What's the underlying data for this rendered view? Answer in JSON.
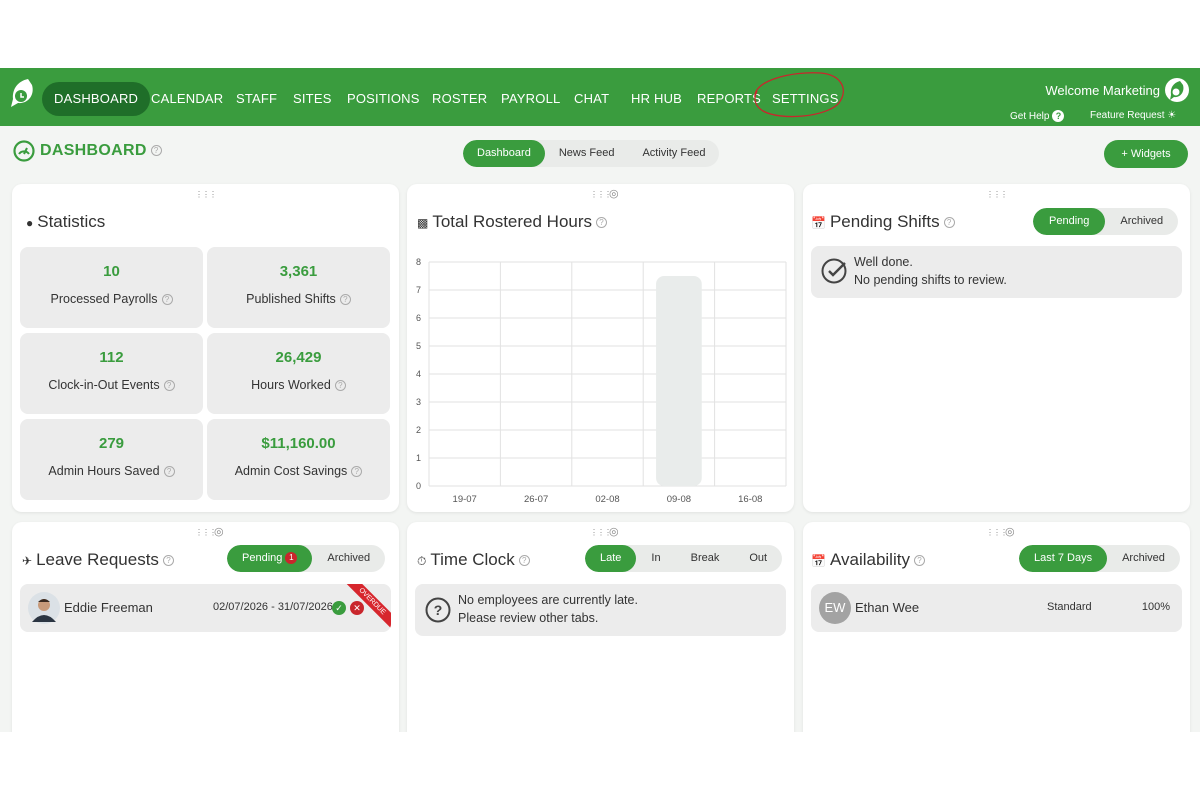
{
  "brand_color": "#3a9c3e",
  "nav": {
    "items": [
      {
        "label": "DASHBOARD",
        "active": true
      },
      {
        "label": "CALENDAR"
      },
      {
        "label": "STAFF"
      },
      {
        "label": "SITES"
      },
      {
        "label": "POSITIONS"
      },
      {
        "label": "ROSTER"
      },
      {
        "label": "PAYROLL"
      },
      {
        "label": "CHAT"
      },
      {
        "label": "HR HUB"
      },
      {
        "label": "REPORTS"
      },
      {
        "label": "SETTINGS"
      }
    ],
    "welcome": "Welcome Marketing",
    "get_help": "Get Help",
    "feature_request": "Feature Request"
  },
  "page": {
    "title": "DASHBOARD",
    "tabs": [
      "Dashboard",
      "News Feed",
      "Activity Feed"
    ],
    "active_tab": "Dashboard",
    "widgets_button": "+ Widgets"
  },
  "statistics": {
    "title": "Statistics",
    "items": [
      {
        "value": "10",
        "label": "Processed Payrolls"
      },
      {
        "value": "3,361",
        "label": "Published Shifts"
      },
      {
        "value": "112",
        "label": "Clock-in-Out Events"
      },
      {
        "value": "26,429",
        "label": "Hours Worked"
      },
      {
        "value": "279",
        "label": "Admin Hours Saved"
      },
      {
        "value": "$11,160.00",
        "label": "Admin Cost Savings"
      }
    ]
  },
  "rostered": {
    "title": "Total Rostered Hours"
  },
  "chart_data": {
    "type": "bar",
    "categories": [
      "19-07",
      "26-07",
      "02-08",
      "09-08",
      "16-08"
    ],
    "values": [
      0,
      0,
      0,
      7.5,
      0
    ],
    "title": "Total Rostered Hours",
    "ylim": [
      0,
      8
    ],
    "yticks": [
      "0",
      "1",
      "2",
      "3",
      "4",
      "5",
      "6",
      "7",
      "8"
    ],
    "grid": true,
    "bar_color": "#e9eceb"
  },
  "pending_shifts": {
    "title": "Pending Shifts",
    "tabs": [
      "Pending",
      "Archived"
    ],
    "line1": "Well done.",
    "line2": "No pending shifts to review."
  },
  "leave": {
    "title": "Leave Requests",
    "tabs": [
      "Pending",
      "Archived"
    ],
    "pending_count": "1",
    "request": {
      "name": "Eddie Freeman",
      "dates": "02/07/2026 - 31/07/2026",
      "ribbon": "OVERDUE"
    }
  },
  "time_clock": {
    "title": "Time Clock",
    "tabs": [
      "Late",
      "In",
      "Break",
      "Out"
    ],
    "line1": "No employees are currently late.",
    "line2": "Please review other tabs."
  },
  "availability": {
    "title": "Availability",
    "tabs": [
      "Last 7 Days",
      "Archived"
    ],
    "row": {
      "initials": "EW",
      "name": "Ethan Wee",
      "type": "Standard",
      "percent": "100%"
    }
  }
}
